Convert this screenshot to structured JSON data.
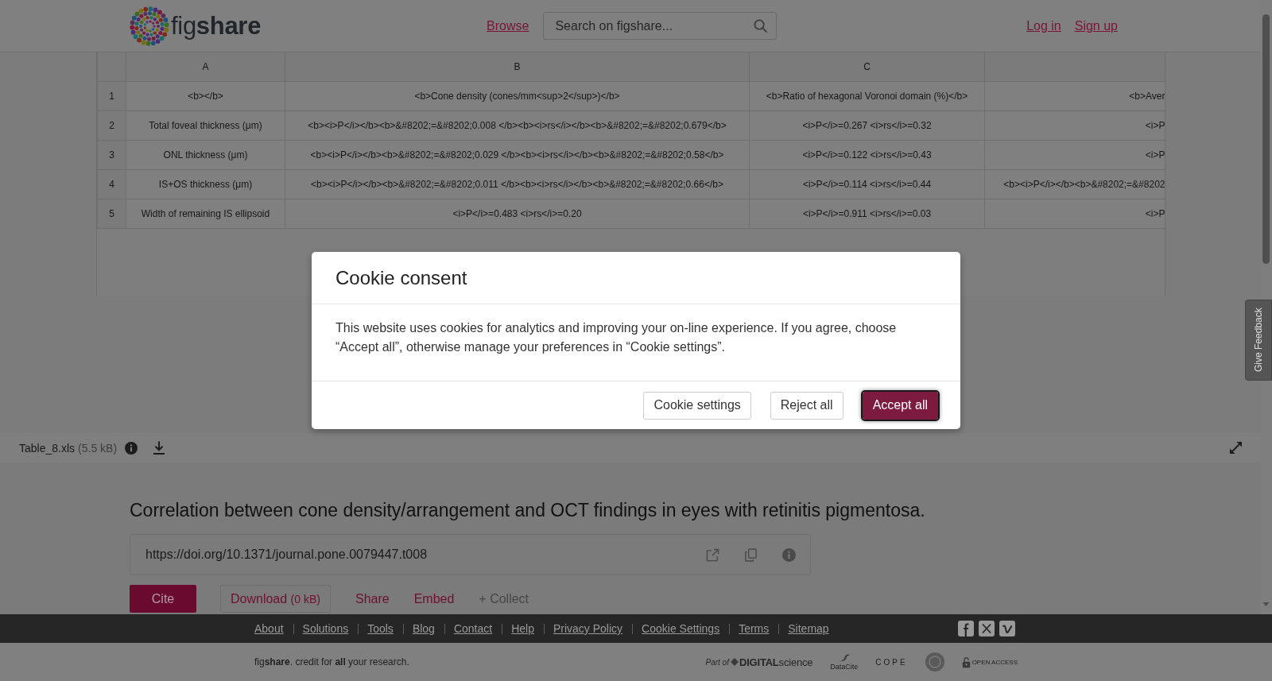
{
  "header": {
    "logo_text": "fig**share**",
    "nav_link": "Browse",
    "search": {
      "placeholder": "Search on figshare..."
    },
    "login": "Log in",
    "signup": "Sign up"
  },
  "sheet": {
    "columns": [
      "A",
      "B",
      "C"
    ],
    "rows": [
      {
        "number": "1",
        "cells": [
          "<b></b>",
          "<b>Cone density (cones/mm<sup>2</sup>)</b>",
          "<b>Ratio of hexagonal Voronoi domain (%)</b>",
          "<b>Aver"
        ]
      },
      {
        "number": "2",
        "cells": [
          "Total foveal thickness (μm)",
          "<b><i>P</i></b><b>&#8202;=&#8202;0.008 </b><b><i>rs</i></b><b>&#8202;=&#8202;0.679</b>",
          "<i>P</i>=0.267 <i>rs</i>=0.32",
          "<i>P"
        ]
      },
      {
        "number": "3",
        "cells": [
          "ONL thickness (μm)",
          "<b><i>P</i></b><b>&#8202;=&#8202;0.029 </b><b><i>rs</i></b><b>&#8202;=&#8202;0.58</b>",
          "<i>P</i>=0.122 <i>rs</i>=0.43",
          "<i>P"
        ]
      },
      {
        "number": "4",
        "cells": [
          "IS+OS thickness (μm)",
          "<b><i>P</i></b><b>&#8202;=&#8202;0.011 </b><b><i>rs</i></b><b>&#8202;=&#8202;0.66</b>",
          "<i>P</i>=0.114 <i>rs</i>=0.44",
          "<b><i>P</i></b><b>&#8202;=&#8202"
        ]
      },
      {
        "number": "5",
        "cells": [
          "Width of remaining IS ellipsoid",
          "<i>P</i>=0.483 <i>rs</i>=0.20",
          "<i>P</i>=0.911 <i>rs</i>=0.03",
          "<i>P"
        ]
      }
    ]
  },
  "file_bar": {
    "name": "Table_8.xls",
    "size": "(5.5 kB)"
  },
  "item": {
    "title": "Correlation between cone density/arrangement and OCT findings in eyes with retinitis pigmentosa.",
    "doi": "https://doi.org/10.1371/journal.pone.0079447.t008",
    "actions": [
      {
        "kind": "cite",
        "label": "Cite"
      },
      {
        "kind": "download",
        "label": "Download",
        "note": "(0 kB)"
      },
      {
        "kind": "share",
        "label": "Share"
      },
      {
        "kind": "embed",
        "label": "Embed"
      },
      {
        "kind": "collect",
        "label": "+ Collect"
      }
    ]
  },
  "cookie_dialog": {
    "title": "Cookie consent",
    "message": "This website uses cookies for analytics and improving your on-line experience. If you agree, choose “Accept all”, otherwise manage your preferences in “Cookie settings”.",
    "buttons": [
      {
        "kind": "settings",
        "label": "Cookie settings",
        "focused": false
      },
      {
        "kind": "reject",
        "label": "Reject all",
        "focused": false
      },
      {
        "kind": "accept",
        "label": "Accept all",
        "focused": true
      }
    ]
  },
  "feedback_tab": "Give Feedback",
  "footer": {
    "links": [
      "About",
      "Solutions",
      "Tools",
      "Blog",
      "Contact",
      "Help",
      "Privacy Policy",
      "Cookie Settings",
      "Terms",
      "Sitemap"
    ],
    "tagline": "fig**share**. credit for **all** your research.",
    "partners": {
      "digital_science": {
        "prefix": "Part of",
        "name": "**DIGITAL**science"
      },
      "datacite": "DataCite",
      "cope": "COPE",
      "open_access": "OPEN ACCESS"
    }
  }
}
